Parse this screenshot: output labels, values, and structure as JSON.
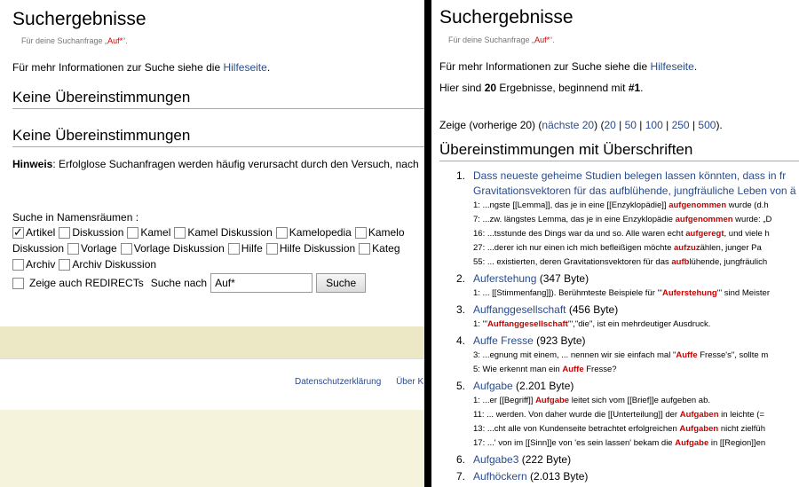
{
  "left": {
    "title": "Suchergebnisse",
    "subtitle_prefix": "Für deine Suchanfrage „",
    "subtitle_query": "Auf*",
    "subtitle_suffix": "“.",
    "info_prefix": "Für mehr Informationen zur Suche siehe die ",
    "info_link": "Hilfeseite",
    "info_suffix": ".",
    "heading1": "Keine Übereinstimmungen",
    "heading2": "Keine Übereinstimmungen",
    "hint_label": "Hinweis",
    "hint_text": ": Erfolglose Suchanfragen werden häufig verursacht durch den Versuch, nach",
    "namespaces_title": "Suche in Namensräumen :",
    "namespaces_row1": [
      {
        "label": "Artikel",
        "checked": true
      },
      {
        "label": "Diskussion",
        "checked": false
      },
      {
        "label": "Kamel",
        "checked": false
      },
      {
        "label": "Kamel Diskussion",
        "checked": false
      },
      {
        "label": "Kamelopedia",
        "checked": false
      },
      {
        "label": "Kamelo",
        "checked": false
      }
    ],
    "namespaces_row2_lead": "Diskussion",
    "namespaces_row2": [
      {
        "label": "Vorlage",
        "checked": false
      },
      {
        "label": "Vorlage Diskussion",
        "checked": false
      },
      {
        "label": "Hilfe",
        "checked": false
      },
      {
        "label": "Hilfe Diskussion",
        "checked": false
      },
      {
        "label": "Kateg",
        "checked": false
      }
    ],
    "namespaces_row3": [
      {
        "label": "Archiv",
        "checked": false
      },
      {
        "label": "Archiv Diskussion",
        "checked": false
      }
    ],
    "redirects_label": "Zeige auch REDIRECTs",
    "search_label": "Suche nach",
    "search_value": "Auf*",
    "search_button": "Suche",
    "footer_privacy": "Datenschutzerklärung",
    "footer_about": "Über K"
  },
  "right": {
    "title": "Suchergebnisse",
    "subtitle_prefix": "Für deine Suchanfrage „",
    "subtitle_query": "Auf*",
    "subtitle_suffix": "“.",
    "info_prefix": "Für mehr Informationen zur Suche siehe die ",
    "info_link": "Hilfeseite",
    "info_suffix": ".",
    "count_prefix": "Hier sind ",
    "count_value": "20",
    "count_mid": " Ergebnisse, beginnend mit ",
    "count_start": "#1",
    "count_suffix": ".",
    "pager_prefix": "Zeige (vorherige 20) (",
    "pager_next": "nächste 20",
    "pager_mid": ") (",
    "pager_sizes": [
      "20",
      "50",
      "100",
      "250",
      "500"
    ],
    "pager_suffix": ").",
    "heading": "Übereinstimmungen mit Überschriften",
    "results": [
      {
        "num": "1.",
        "title": "Dass neueste geheime Studien belegen lassen könnten, dass in fr",
        "title2": "Gravitationsvektoren für das aufblühende, jungfräuliche Leben von ä",
        "size": "",
        "snippets": [
          {
            "pre": "1: ...ngste [[Lemma]], das je in eine [[Enzyklopädie]] ",
            "hl": "aufgenommen",
            "post": " wurde (d.h"
          },
          {
            "pre": "7: ...zw. längstes Lemma, das je in eine Enzyklopädie ",
            "hl": "aufgenommen",
            "post": " wurde: „D"
          },
          {
            "pre": "16: ...tsstunde des Dings war da und so. Alle waren echt ",
            "hl": "aufgeregt",
            "post": ", und viele h"
          },
          {
            "pre": "27: ...derer ich nur einen ich mich befleißigen möchte ",
            "hl": "aufzuz",
            "post": "ählen, junger Pa"
          },
          {
            "pre": "55: ... existierten, deren Gravitationsvektoren für das ",
            "hl": "aufb",
            "post": "lühende, jungfräulich"
          }
        ]
      },
      {
        "num": "2.",
        "title": "Auferstehung",
        "size": " (347 Byte)",
        "snippets": [
          {
            "pre": "1: ... [[Stimmenfang]]). Berühmteste Beispiele für '''",
            "hl": "Auferstehung",
            "post": "''' sind Meister"
          }
        ]
      },
      {
        "num": "3.",
        "title": "Auffanggesellschaft",
        "size": " (456 Byte)",
        "snippets": [
          {
            "pre": "1: '''",
            "hl": "Auffanggesellschaft",
            "post": "''',\"die\", ist ein mehrdeutiger Ausdruck."
          }
        ]
      },
      {
        "num": "4.",
        "title": "Auffe Fresse",
        "size": " (923 Byte)",
        "snippets": [
          {
            "pre": "3: ...egnung mit einem, ... nennen wir sie einfach mal \"",
            "hl": "Auffe",
            "post": " Fresse's\", sollte m"
          },
          {
            "pre": "5: Wie erkennt man ein ",
            "hl": "Auffe",
            "post": " Fresse?"
          }
        ]
      },
      {
        "num": "5.",
        "title": "Aufgabe",
        "size": " (2.201 Byte)",
        "snippets": [
          {
            "pre": "1: ...er [[Begriff]] ",
            "hl": "Aufgabe",
            "post": " leitet sich vom [[Brief]]e aufgeben ab."
          },
          {
            "pre": "11: ... werden. Von daher wurde die [[Unterteilung]] der ",
            "hl": "Aufgaben",
            "post": " in leichte (="
          },
          {
            "pre": "13: ...cht alle von Kundenseite betrachtet erfolgreichen ",
            "hl": "Aufgaben",
            "post": " nicht zielfüh"
          },
          {
            "pre": "17: ...' von im [[Sinn]]e von 'es sein lassen' bekam die ",
            "hl": "Aufgabe",
            "post": " in [[Region]]en"
          }
        ]
      },
      {
        "num": "6.",
        "title": "Aufgabe3",
        "size": " (222 Byte)",
        "snippets": []
      },
      {
        "num": "7.",
        "title": "Aufhöckern",
        "size": " (2.013 Byte)",
        "snippets": [
          {
            "pre": "1: ...öckern''' bezeichnet man die beschleunigte Wasser",
            "hl": "aufnahmepraxis",
            "post": " für [[K"
          }
        ]
      }
    ]
  }
}
